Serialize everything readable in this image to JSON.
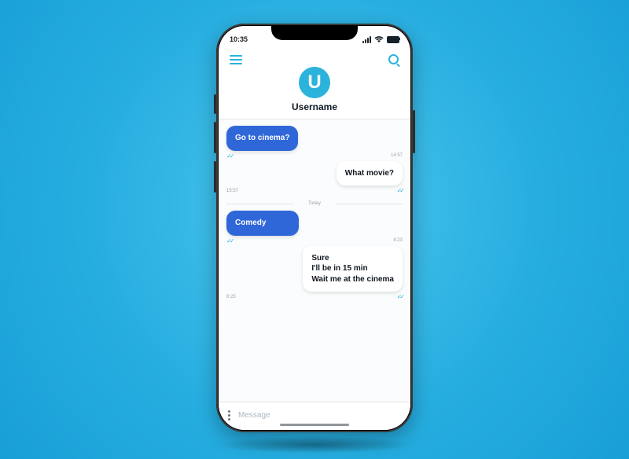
{
  "status": {
    "time": "10:35"
  },
  "header": {
    "avatar_initial": "U",
    "username": "Username"
  },
  "chat": {
    "messages": [
      {
        "side": "left",
        "type": "sent",
        "lines": [
          "Go to cinema?"
        ],
        "time": "14:57"
      },
      {
        "side": "right",
        "type": "recv",
        "lines": [
          "What movie?"
        ],
        "time": "15:57"
      }
    ],
    "divider": "Today",
    "messages2": [
      {
        "side": "left",
        "type": "sent",
        "lines": [
          "Comedy"
        ],
        "time": "8:23"
      },
      {
        "side": "right",
        "type": "recv",
        "lines": [
          "Sure",
          "I'll be in 15 min",
          "Wait me at the cinema"
        ],
        "time": "8:25"
      }
    ]
  },
  "input": {
    "placeholder": "Message"
  }
}
